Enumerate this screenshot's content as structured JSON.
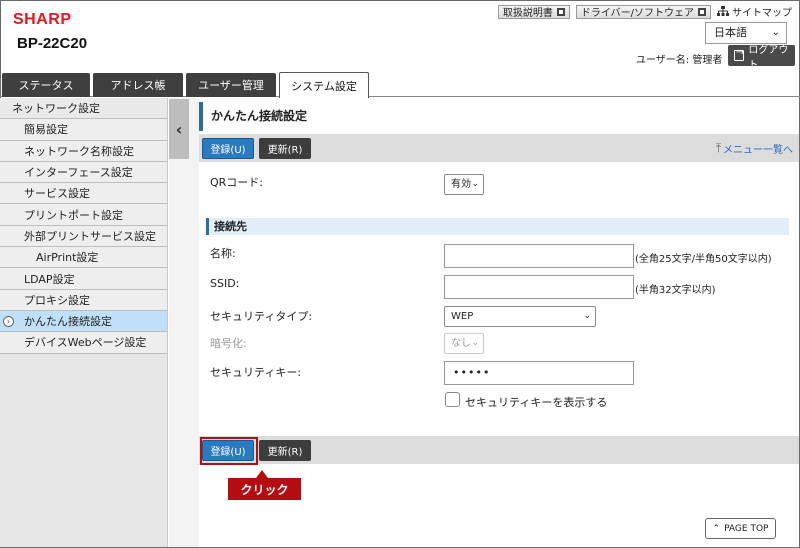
{
  "header": {
    "logo": "SHARP",
    "model": "BP-22C20",
    "links": [
      {
        "label": "取扱説明書"
      },
      {
        "label": "ドライバー/ソフトウェア"
      }
    ],
    "sitemap": "サイトマップ",
    "language": "日本語",
    "user": "ユーザー名: 管理者",
    "logout": "ログアウト"
  },
  "tabs": [
    {
      "label": "ステータス"
    },
    {
      "label": "アドレス帳"
    },
    {
      "label": "ユーザー管理"
    },
    {
      "label": "システム設定"
    }
  ],
  "sidebar": {
    "items": [
      {
        "label": "ネットワーク設定"
      },
      {
        "label": "簡易設定"
      },
      {
        "label": "ネットワーク名称設定"
      },
      {
        "label": "インターフェース設定"
      },
      {
        "label": "サービス設定"
      },
      {
        "label": "プリントポート設定"
      },
      {
        "label": "外部プリントサービス設定"
      },
      {
        "label": "AirPrint設定"
      },
      {
        "label": "LDAP設定"
      },
      {
        "label": "プロキシ設定"
      },
      {
        "label": "かんたん接続設定"
      },
      {
        "label": "デバイスWebページ設定"
      }
    ]
  },
  "main": {
    "title": "かんたん接続設定",
    "register": "登録(U)",
    "update": "更新(R)",
    "menu_link": "メニュー一覧へ",
    "qr_label": "QRコード:",
    "qr_value": "有効",
    "section": "接続先",
    "name_label": "名称:",
    "name_hint": "(全角25文字/半角50文字以内)",
    "ssid_label": "SSID:",
    "ssid_hint": "(半角32文字以内)",
    "sectype_label": "セキュリティタイプ:",
    "sectype_value": "WEP",
    "enc_label": "暗号化:",
    "enc_value": "なし",
    "key_label": "セキュリティキー:",
    "key_value": "•••••",
    "show_key": "セキュリティキーを表示する",
    "callout": "クリック",
    "pagetop": "PAGE TOP"
  }
}
